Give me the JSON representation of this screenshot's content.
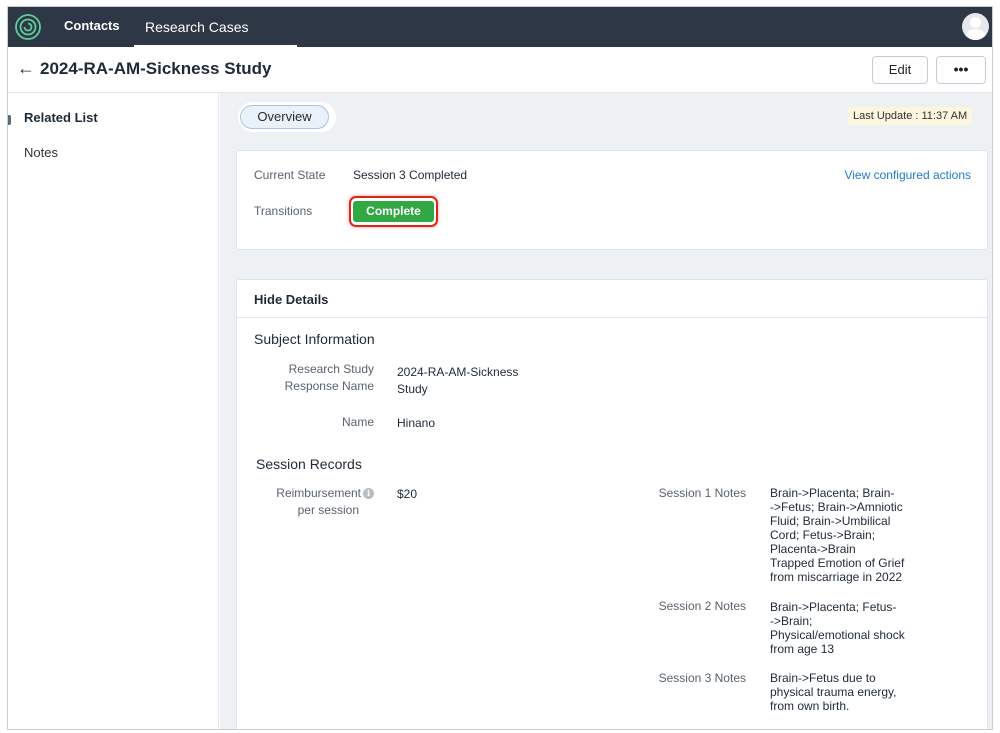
{
  "nav": {
    "contacts": "Contacts",
    "research_cases": "Research Cases"
  },
  "header": {
    "title": "2024-RA-AM-Sickness Study",
    "edit_label": "Edit",
    "more_label": "•••"
  },
  "sidebar": {
    "heading": "Related List",
    "items": [
      {
        "label": "Notes"
      }
    ]
  },
  "main": {
    "tab_overview": "Overview",
    "last_update": "Last Update : 11:37 AM",
    "state": {
      "current_state_label": "Current State",
      "current_state_value": "Session 3 Completed",
      "view_actions": "View configured actions",
      "transitions_label": "Transitions",
      "complete_label": "Complete"
    },
    "details": {
      "hide_details": "Hide Details",
      "subject_section": "Subject Information",
      "response_name_label_1": "Research Study",
      "response_name_label_2": "Response Name",
      "response_name_value_1": "2024-RA-AM-Sickness",
      "response_name_value_2": "Study",
      "name_label": "Name",
      "name_value": "Hinano",
      "session_section": "Session Records",
      "reimb_label_1": "Reimbursement",
      "reimb_label_2": "per session",
      "reimb_value": "$20",
      "session1_label": "Session 1 Notes",
      "session1_lines": [
        "Brain->Placenta; Brain-",
        "->Fetus; Brain->Amniotic",
        "Fluid; Brain->Umbilical",
        "Cord; Fetus->Brain;",
        "Placenta->Brain",
        "Trapped Emotion of Grief",
        "from miscarriage in 2022"
      ],
      "session2_label": "Session 2 Notes",
      "session2_lines": [
        "Brain->Placenta; Fetus-",
        "->Brain;",
        "Physical/emotional shock",
        "from age 13"
      ],
      "session3_label": "Session 3 Notes",
      "session3_lines": [
        "Brain->Fetus due to",
        "physical trauma energy,",
        "from own birth."
      ]
    }
  },
  "colors": {
    "topbar": "#2e3745",
    "complete_button": "#31a844",
    "highlight_ring": "#d8281a",
    "link": "#1f7ad1"
  }
}
